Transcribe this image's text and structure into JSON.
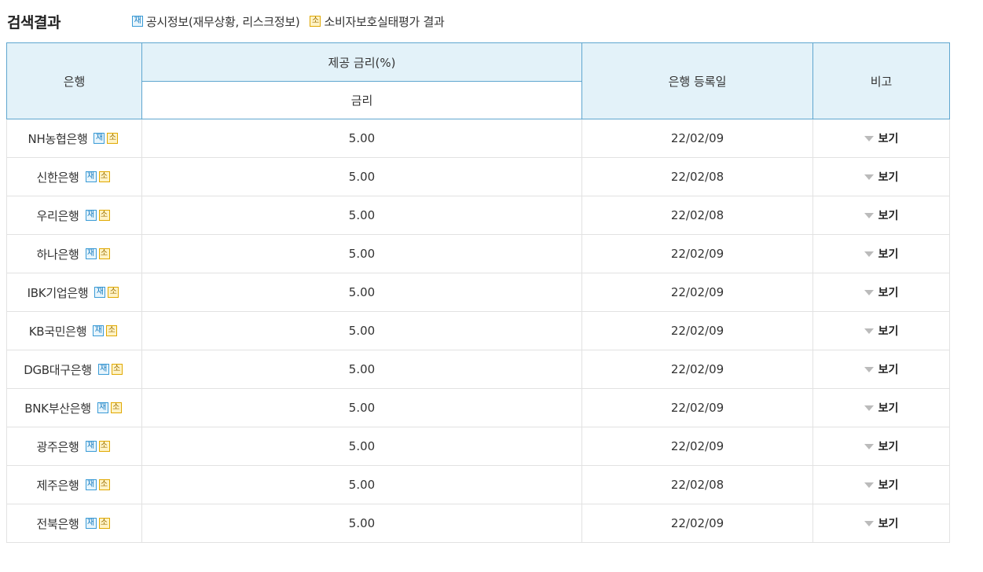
{
  "header": {
    "title": "검색결과",
    "legend": [
      {
        "badge": "재",
        "label": "공시정보(재무상황, 리스크정보)"
      },
      {
        "badge": "소",
        "label": "소비자보호실태평가 결과"
      }
    ]
  },
  "table": {
    "headers": {
      "bank": "은행",
      "rate_group": "제공 금리(%)",
      "rate_sub": "금리",
      "date": "은행 등록일",
      "note": "비고"
    },
    "badges": {
      "jae": "재",
      "so": "소"
    },
    "view_label": "보기",
    "rows": [
      {
        "bank": "NH농협은행",
        "rate": "5.00",
        "date": "22/02/09"
      },
      {
        "bank": "신한은행",
        "rate": "5.00",
        "date": "22/02/08"
      },
      {
        "bank": "우리은행",
        "rate": "5.00",
        "date": "22/02/08"
      },
      {
        "bank": "하나은행",
        "rate": "5.00",
        "date": "22/02/09"
      },
      {
        "bank": "IBK기업은행",
        "rate": "5.00",
        "date": "22/02/09"
      },
      {
        "bank": "KB국민은행",
        "rate": "5.00",
        "date": "22/02/09"
      },
      {
        "bank": "DGB대구은행",
        "rate": "5.00",
        "date": "22/02/09"
      },
      {
        "bank": "BNK부산은행",
        "rate": "5.00",
        "date": "22/02/09"
      },
      {
        "bank": "광주은행",
        "rate": "5.00",
        "date": "22/02/09"
      },
      {
        "bank": "제주은행",
        "rate": "5.00",
        "date": "22/02/08"
      },
      {
        "bank": "전북은행",
        "rate": "5.00",
        "date": "22/02/09"
      }
    ]
  },
  "colors": {
    "header_bg": "#e3f2f9",
    "header_border": "#5fa6cf",
    "badge_jae": "#3a9bd6",
    "badge_so": "#e0a800"
  }
}
